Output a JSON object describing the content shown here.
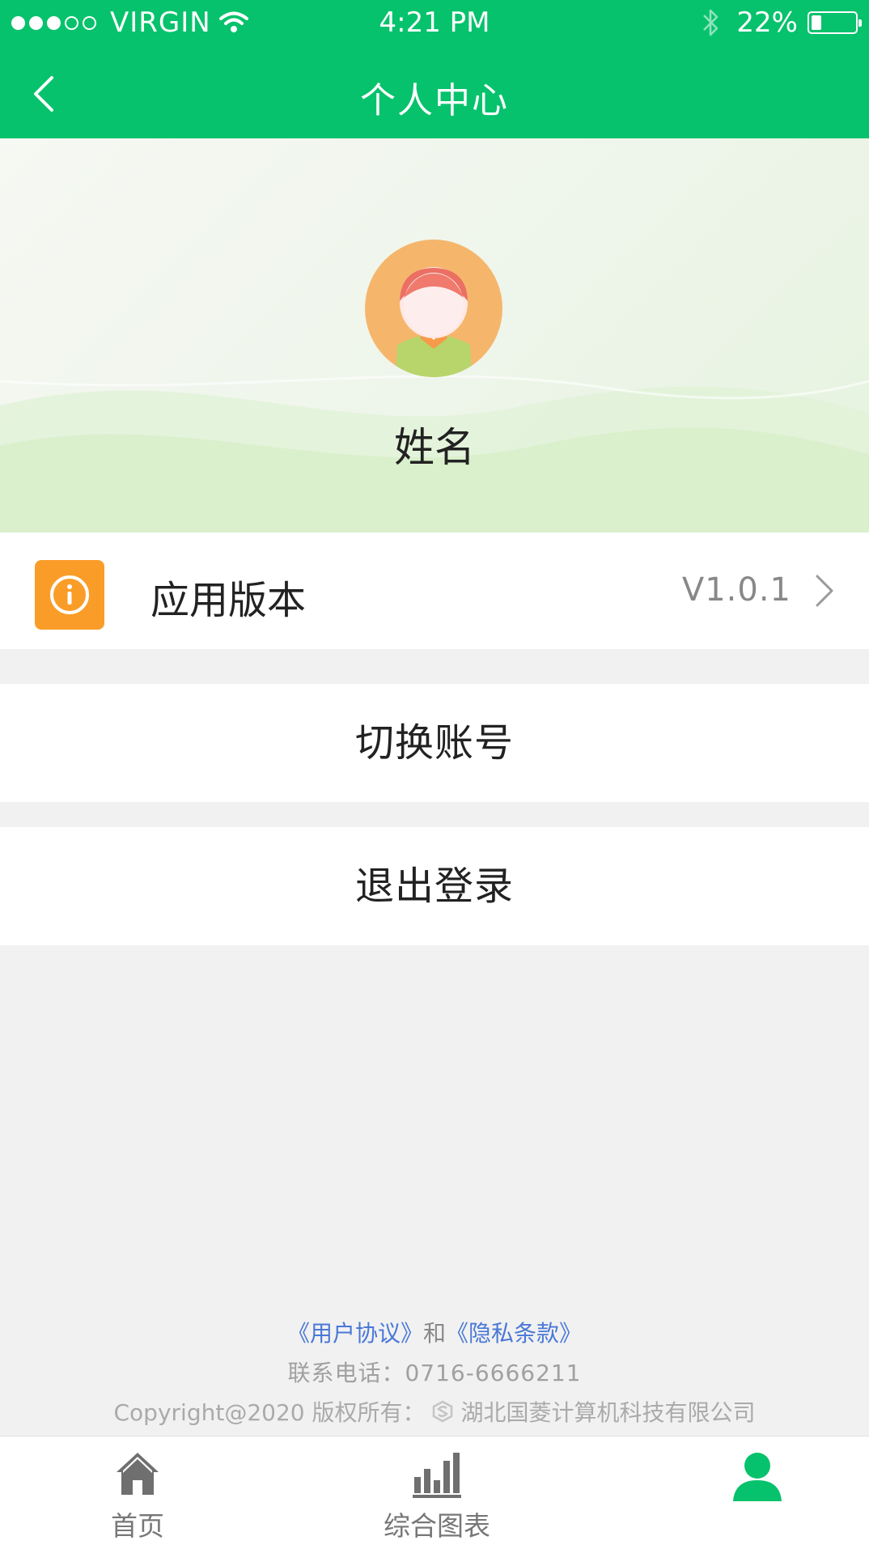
{
  "status_bar": {
    "carrier": "VIRGIN",
    "time": "4:21 PM",
    "battery": "22%",
    "battery_level": 0.22
  },
  "navbar": {
    "title": "个人中心",
    "back_icon": "chevron-left-icon"
  },
  "profile": {
    "name": "姓名",
    "avatar_icon": "user-avatar"
  },
  "menu": {
    "version_label": "应用版本",
    "version_value": "V1.0.1",
    "version_icon": "info-icon",
    "switch_account": "切换账号",
    "logout": "退出登录"
  },
  "footer": {
    "user_agreement": "《用户协议》",
    "and": "和",
    "privacy_policy": "《隐私条款》",
    "phone": "联系电话：0716-6666211",
    "copyright": "Copyright@2020 版权所有：",
    "company": "湖北国菱计算机科技有限公司"
  },
  "tabs": [
    {
      "label": "首页",
      "icon": "home-icon",
      "active": false
    },
    {
      "label": "综合图表",
      "icon": "bar-chart-icon",
      "active": false
    },
    {
      "label": "",
      "icon": "person-icon",
      "active": true
    }
  ],
  "colors": {
    "primary": "#07c26c",
    "accent_orange": "#fa9d28",
    "link_blue": "#4a78d6"
  }
}
